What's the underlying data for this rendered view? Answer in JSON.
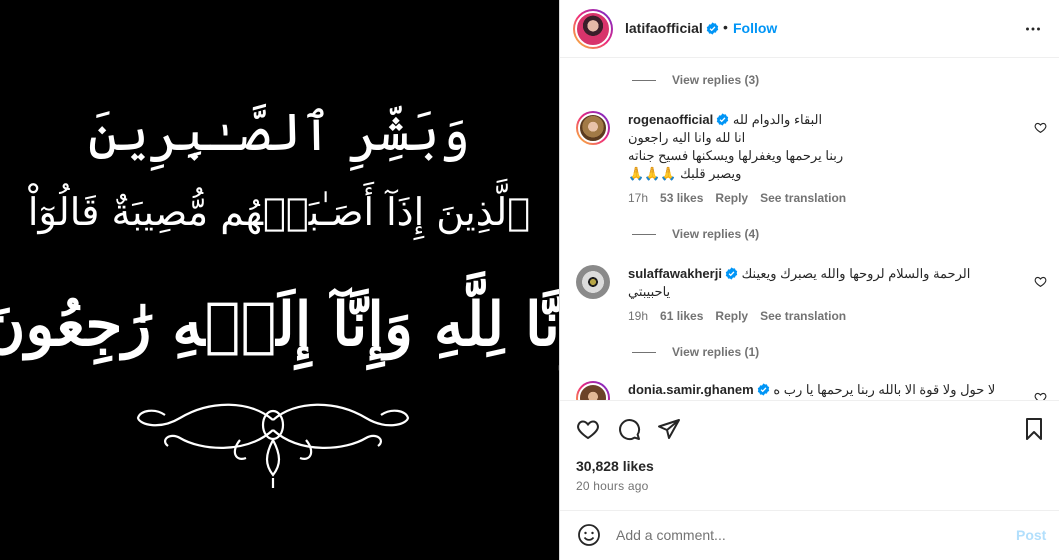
{
  "media": {
    "line1": "وَبَشِّرِ ٱلصَّـٰبِرِينَ",
    "line2": "ٱلَّذِينَ إِذَآ أَصَـٰبَتۡهُم مُّصِيبَةٌ قَالُوٓاْ",
    "line3": "إِنَّا لِلَّهِ وَإِنَّآ إِلَيۡهِ رَٰجِعُونَ",
    "ornament": "decorative-flourish"
  },
  "header": {
    "username": "latifaofficial",
    "separator": "•",
    "follow_label": "Follow",
    "more_icon": "more-horizontal-icon"
  },
  "comments": {
    "replies_top": "View replies (3)",
    "items": [
      {
        "username": "rogenaofficial",
        "text_lines": [
          "البقاء والدوام لله",
          "انا لله وانا اليه راجعون",
          "ربنا يرحمها ويغفرلها ويسكنها فسيح جناته",
          "ويصبر قلبك 🙏🙏🙏"
        ],
        "time": "17h",
        "likes": "53 likes",
        "reply": "Reply",
        "translate": "See translation",
        "replies": "View replies (4)"
      },
      {
        "username": "sulaffawakherji",
        "text_lines": [
          "الرحمة والسلام لروحها والله يصبرك ويعينك",
          "ياحبيبتي"
        ],
        "time": "19h",
        "likes": "61 likes",
        "reply": "Reply",
        "translate": "See translation",
        "replies": "View replies (1)"
      },
      {
        "username": "donia.samir.ghanem",
        "text_lines": [
          "لا حول ولا قوة الا بالله ربنا يرحمها يا رب ه"
        ]
      }
    ]
  },
  "actions": {
    "like_icon": "heart-icon",
    "comment_icon": "comment-icon",
    "share_icon": "share-icon",
    "save_icon": "bookmark-icon",
    "likes_count": "30,828 likes",
    "posted": "20 hours ago"
  },
  "add_comment": {
    "placeholder": "Add a comment...",
    "post_label": "Post",
    "emoji_icon": "emoji-icon"
  },
  "colors": {
    "accent": "#0095f6",
    "verified": "#0095f6",
    "muted": "#737373",
    "post_disabled": "#b2dffc"
  }
}
